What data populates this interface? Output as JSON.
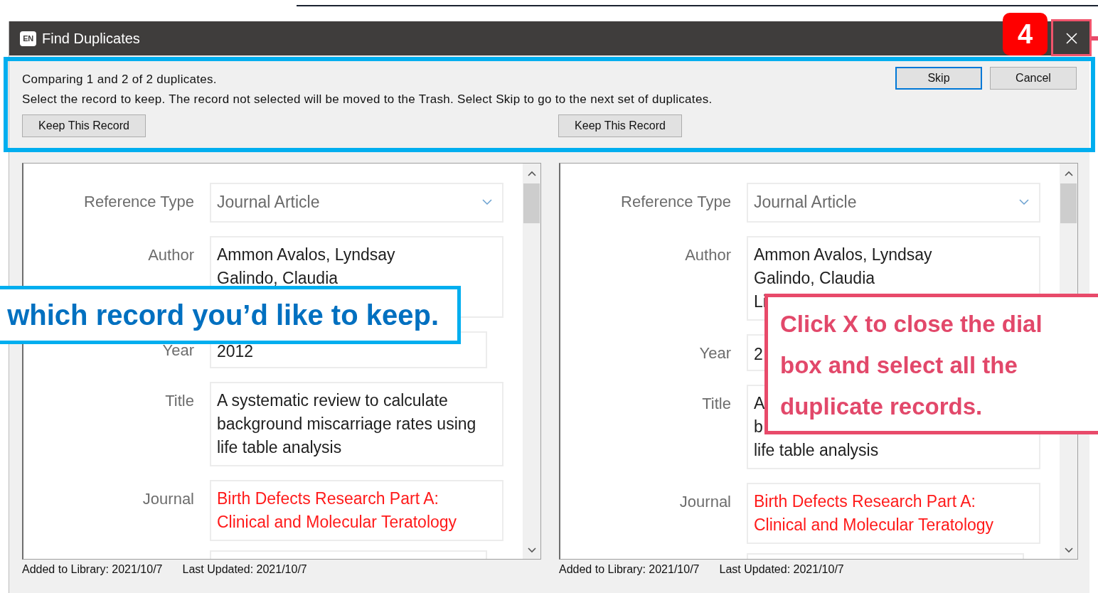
{
  "window": {
    "logo": "EN",
    "title": "Find Duplicates"
  },
  "toolbar": {
    "status": "Comparing 1 and 2 of 2 duplicates.",
    "instructions": "Select the record to keep. The record not selected will be moved to the Trash. Select Skip to go to the next set of duplicates.",
    "buttons": [
      {
        "label": "Skip",
        "default": true
      },
      {
        "label": "Cancel",
        "default": false
      }
    ]
  },
  "records": [
    {
      "keep_button": "Keep This Record",
      "fields": [
        {
          "kind": "dropdown",
          "label": "Reference Type",
          "lines": [
            "Journal Article"
          ],
          "differs": false
        },
        {
          "kind": "multiline",
          "label": "Author",
          "lines": [
            "Ammon Avalos, Lyndsay",
            "Galindo, Claudia"
          ],
          "differs": false
        },
        {
          "kind": "short",
          "label": "Year",
          "lines": [
            "2012"
          ],
          "differs": false
        },
        {
          "kind": "multiline",
          "label": "Title",
          "lines": [
            "A systematic review to calculate",
            "background miscarriage rates using",
            "life table analysis"
          ],
          "differs": false
        },
        {
          "kind": "multiline",
          "label": "Journal",
          "lines": [
            "Birth Defects Research Part A:",
            "Clinical and Molecular Teratology"
          ],
          "differs": true
        },
        {
          "kind": "empty"
        }
      ],
      "footer": [
        "Added to Library: 2021/10/7",
        "Last Updated: 2021/10/7"
      ]
    },
    {
      "keep_button": "Keep This Record",
      "fields": [
        {
          "kind": "dropdown",
          "label": "Reference Type",
          "lines": [
            "Journal Article"
          ],
          "differs": false
        },
        {
          "kind": "multiline",
          "label": "Author",
          "lines": [
            "Ammon Avalos, Lyndsay",
            "Galindo, Claudia",
            "Li"
          ],
          "differs": false
        },
        {
          "kind": "short",
          "label": "Year",
          "lines": [
            "2"
          ],
          "differs": false
        },
        {
          "kind": "multiline",
          "label": "Title",
          "lines": [
            "A",
            "b",
            "life table analysis"
          ],
          "differs": false
        },
        {
          "kind": "multiline",
          "label": "Journal",
          "lines": [
            "Birth Defects Research Part A:",
            "Clinical and Molecular Teratology"
          ],
          "differs": true
        },
        {
          "kind": "empty"
        }
      ],
      "footer": [
        "Added to Library: 2021/10/7",
        "Last Updated: 2021/10/7"
      ]
    }
  ],
  "annotations": {
    "step_badge": "4",
    "callouts": [
      {
        "kind": "blue",
        "lines": [
          "which record you’d like to keep."
        ]
      },
      {
        "kind": "pink",
        "lines": [
          "Click X to close the dial",
          "box and select all the",
          "duplicate records."
        ]
      }
    ]
  }
}
